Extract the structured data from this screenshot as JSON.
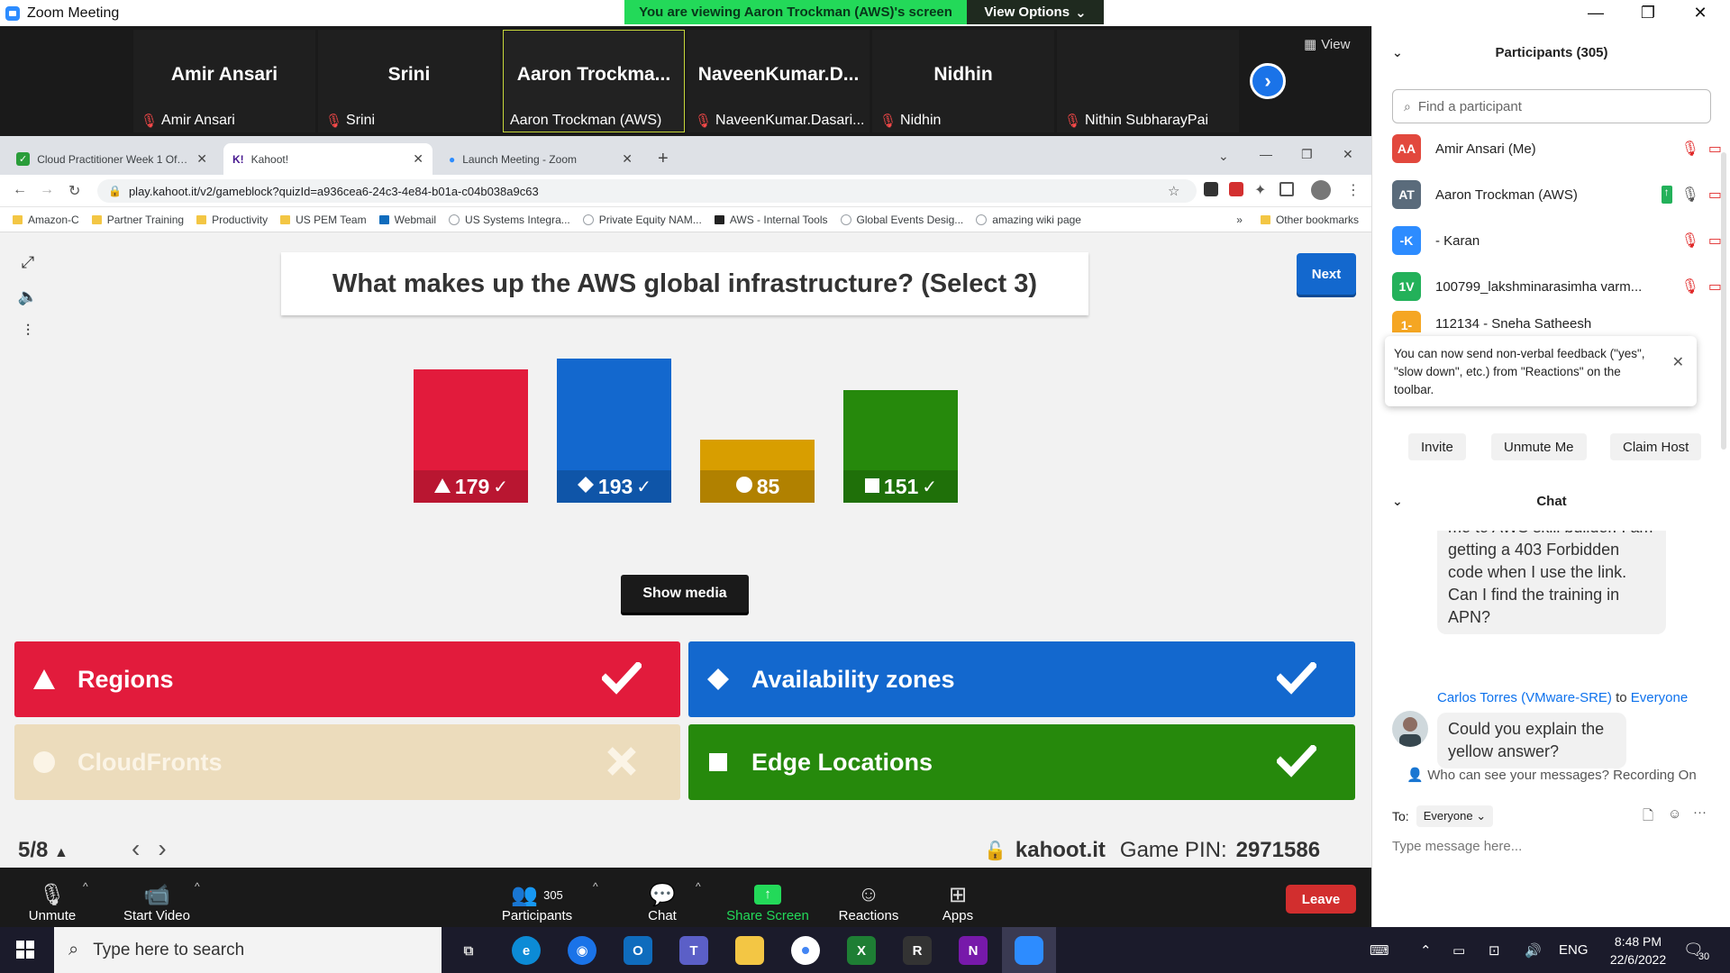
{
  "window": {
    "title": "Zoom Meeting",
    "banner": "You are viewing Aaron Trockman (AWS)'s screen",
    "view_options": "View Options",
    "view_label": "View"
  },
  "video_strip": [
    {
      "big": "Amir Ansari",
      "small": "Amir Ansari"
    },
    {
      "big": "Srini",
      "small": "Srini"
    },
    {
      "big": "Aaron  Trockma...",
      "small": "Aaron Trockman (AWS)"
    },
    {
      "big": "NaveenKumar.D...",
      "small": "NaveenKumar.Dasari..."
    },
    {
      "big": "Nidhin",
      "small": "Nidhin"
    },
    {
      "big": "",
      "small": "Nithin SubharayPai"
    }
  ],
  "browser": {
    "tabs": [
      {
        "label": "Cloud Practitioner Week 1 Office"
      },
      {
        "label": "Kahoot!"
      },
      {
        "label": "Launch Meeting - Zoom"
      }
    ],
    "url": "play.kahoot.it/v2/gameblock?quizId=a936cea6-24c3-4e84-b01a-c04b038a9c63",
    "bookmarks": [
      "Amazon-C",
      "Partner Training",
      "Productivity",
      "US PEM Team",
      "Webmail",
      "US Systems Integra...",
      "Private Equity NAM...",
      "AWS - Internal Tools",
      "Global Events Desig...",
      "amazing wiki page"
    ],
    "other_bookmarks": "Other bookmarks"
  },
  "kahoot": {
    "question": "What makes up the AWS global infrastructure? (Select 3)",
    "next_label": "Next",
    "show_media": "Show media",
    "page_counter": "5/8",
    "site": "kahoot.it",
    "pin_label": "Game PIN:",
    "pin_value": "2971586"
  },
  "chart_data": {
    "type": "bar",
    "categories": [
      "Regions",
      "Availability zones",
      "CloudFronts",
      "Edge Locations"
    ],
    "values": [
      179,
      193,
      85,
      151
    ],
    "correct": [
      true,
      true,
      false,
      true
    ],
    "colors": [
      "#e21b3c",
      "#1368ce",
      "#d89e00",
      "#26890c"
    ]
  },
  "answers": [
    {
      "label": "Regions",
      "shape": "triangle",
      "correct": true,
      "color": "#e21b3c"
    },
    {
      "label": "Availability zones",
      "shape": "diamond",
      "correct": true,
      "color": "#1368ce"
    },
    {
      "label": "CloudFronts",
      "shape": "circle",
      "correct": false,
      "color": "#ecdcbc"
    },
    {
      "label": "Edge Locations",
      "shape": "square",
      "correct": true,
      "color": "#26890c"
    }
  ],
  "toolbar": {
    "unmute": "Unmute",
    "start_video": "Start Video",
    "participants": "Participants",
    "participants_count": "305",
    "chat": "Chat",
    "share_screen": "Share Screen",
    "reactions": "Reactions",
    "apps": "Apps",
    "leave": "Leave"
  },
  "participants_panel": {
    "title": "Participants (305)",
    "search_placeholder": "Find a participant",
    "rows": [
      {
        "initials": "AA",
        "name": "Amir Ansari (Me)",
        "color": "#e2483d"
      },
      {
        "initials": "AT",
        "name": "Aaron Trockman (AWS)",
        "color": "#5a6b7b"
      },
      {
        "initials": "-K",
        "name": "- Karan",
        "color": "#2d8cff"
      },
      {
        "initials": "1V",
        "name": "100799_lakshminarasimha varm...",
        "color": "#23b15a"
      },
      {
        "initials": "1-",
        "name": "112134 - Sneha Satheesh",
        "color": "#f5a623"
      }
    ],
    "toast": "You can now send non-verbal feedback (\"yes\", \"slow down\", etc.) from \"Reactions\" on the toolbar.",
    "invite": "Invite",
    "unmute_me": "Unmute Me",
    "claim_host": "Claim Host"
  },
  "chat": {
    "title": "Chat",
    "prev_message": "me to AWS skill builder. I am getting a 403 Forbidden code when I use the link. Can I find the training in APN?",
    "sender": "Carlos Torres (VMware-SRE)",
    "to_word": "to",
    "recipient": "Everyone",
    "message": "Could you explain the yellow answer?",
    "notice": "Who can see your messages? Recording On",
    "to_label": "To:",
    "to_value": "Everyone",
    "input_placeholder": "Type message here..."
  },
  "taskbar": {
    "search_placeholder": "Type here to search",
    "lang": "ENG",
    "time": "8:48 PM",
    "date": "22/6/2022",
    "notifications": "30"
  }
}
